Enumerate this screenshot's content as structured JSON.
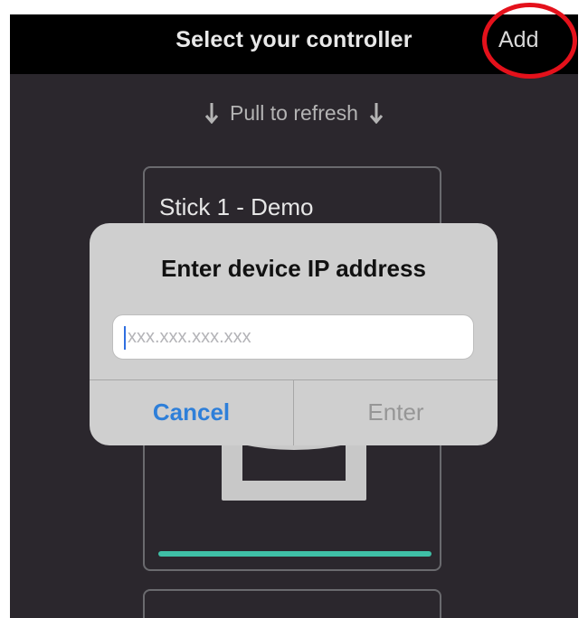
{
  "navbar": {
    "title": "Select your controller",
    "add_label": "Add"
  },
  "refresh": {
    "label": "Pull to refresh",
    "arrow_icon": "arrow-down-icon"
  },
  "card": {
    "title": "Stick 1 - Demo",
    "accent": "#3fbfa6"
  },
  "dialog": {
    "title": "Enter device IP address",
    "input_value": "",
    "input_placeholder": "xxx.xxx.xxx.xxx",
    "cancel_label": "Cancel",
    "enter_label": "Enter"
  },
  "colors": {
    "highlight": "#e4111b",
    "link": "#2e7fd9"
  }
}
